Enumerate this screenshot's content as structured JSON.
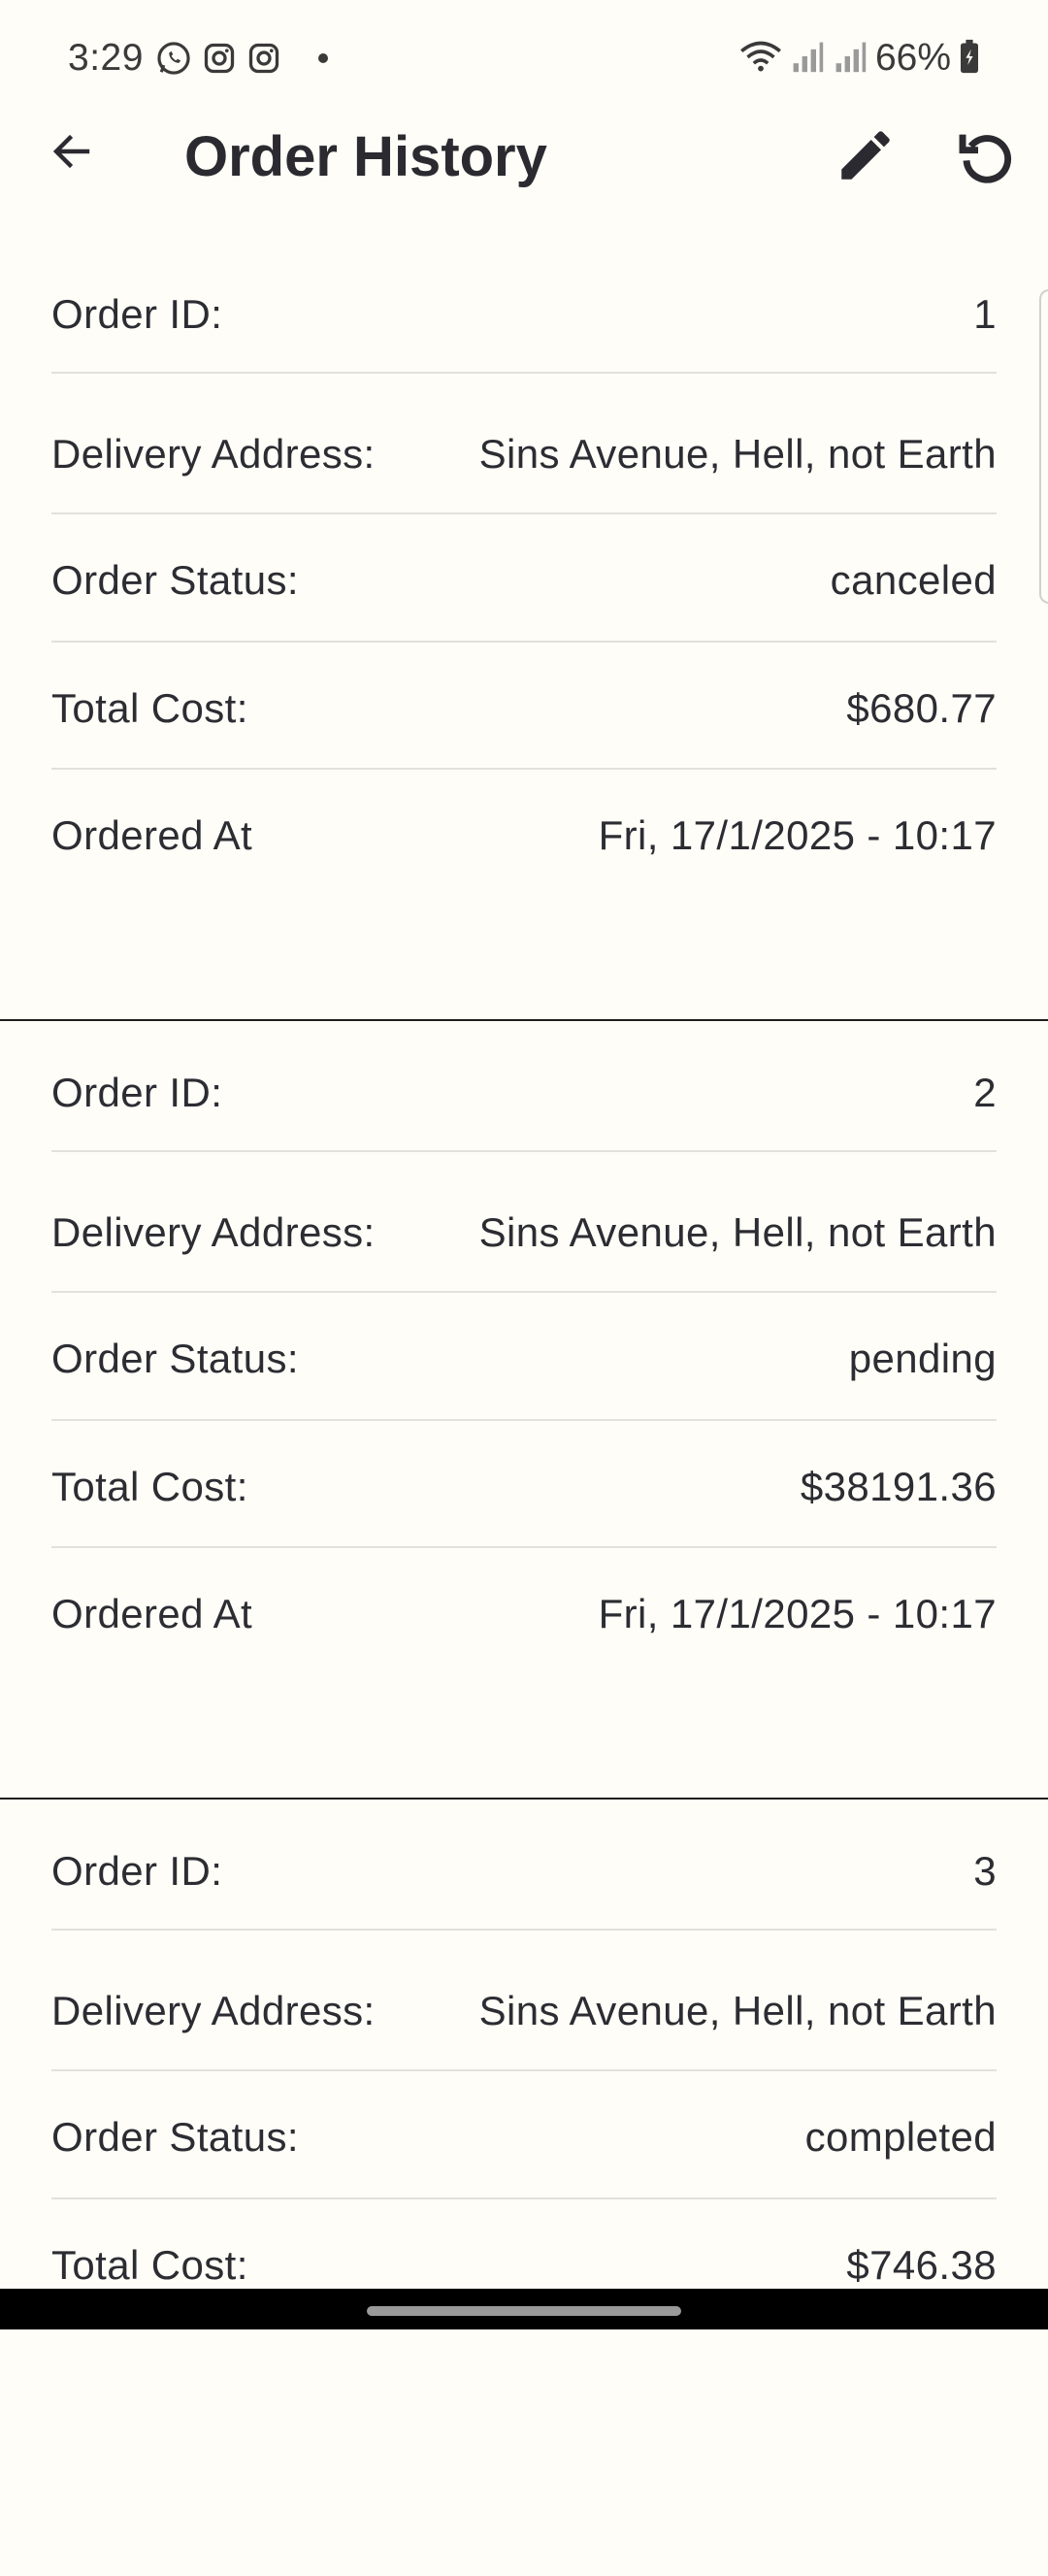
{
  "status_bar": {
    "time": "3:29",
    "battery": "66%",
    "left_icons": [
      "whatsapp-icon",
      "instagram-icon",
      "instagram-icon"
    ],
    "right_icons": [
      "wifi-icon",
      "signal-icon",
      "signal-icon",
      "battery-icon"
    ]
  },
  "app_bar": {
    "title": "Order History",
    "icons": [
      "back-arrow-icon",
      "pencil-icon",
      "refresh-icon"
    ]
  },
  "orders": [
    {
      "id_label": "Order ID:",
      "id": "1",
      "address_label": "Delivery Address:",
      "address": "Sins Avenue, Hell, not Earth",
      "status_label": "Order Status:",
      "status": "canceled",
      "cost_label": "Total Cost:",
      "cost": "$680.77",
      "ordered_label": "Ordered At",
      "ordered_at": "Fri, 17/1/2025 - 10:17"
    },
    {
      "id_label": "Order ID:",
      "id": "2",
      "address_label": "Delivery Address:",
      "address": "Sins Avenue, Hell, not Earth",
      "status_label": "Order Status:",
      "status": "pending",
      "cost_label": "Total Cost:",
      "cost": "$38191.36",
      "ordered_label": "Ordered At",
      "ordered_at": "Fri, 17/1/2025 - 10:17"
    },
    {
      "id_label": "Order ID:",
      "id": "3",
      "address_label": "Delivery Address:",
      "address": "Sins Avenue, Hell, not Earth",
      "status_label": "Order Status:",
      "status": "completed",
      "cost_label": "Total Cost:",
      "cost": "$746.38"
    }
  ]
}
